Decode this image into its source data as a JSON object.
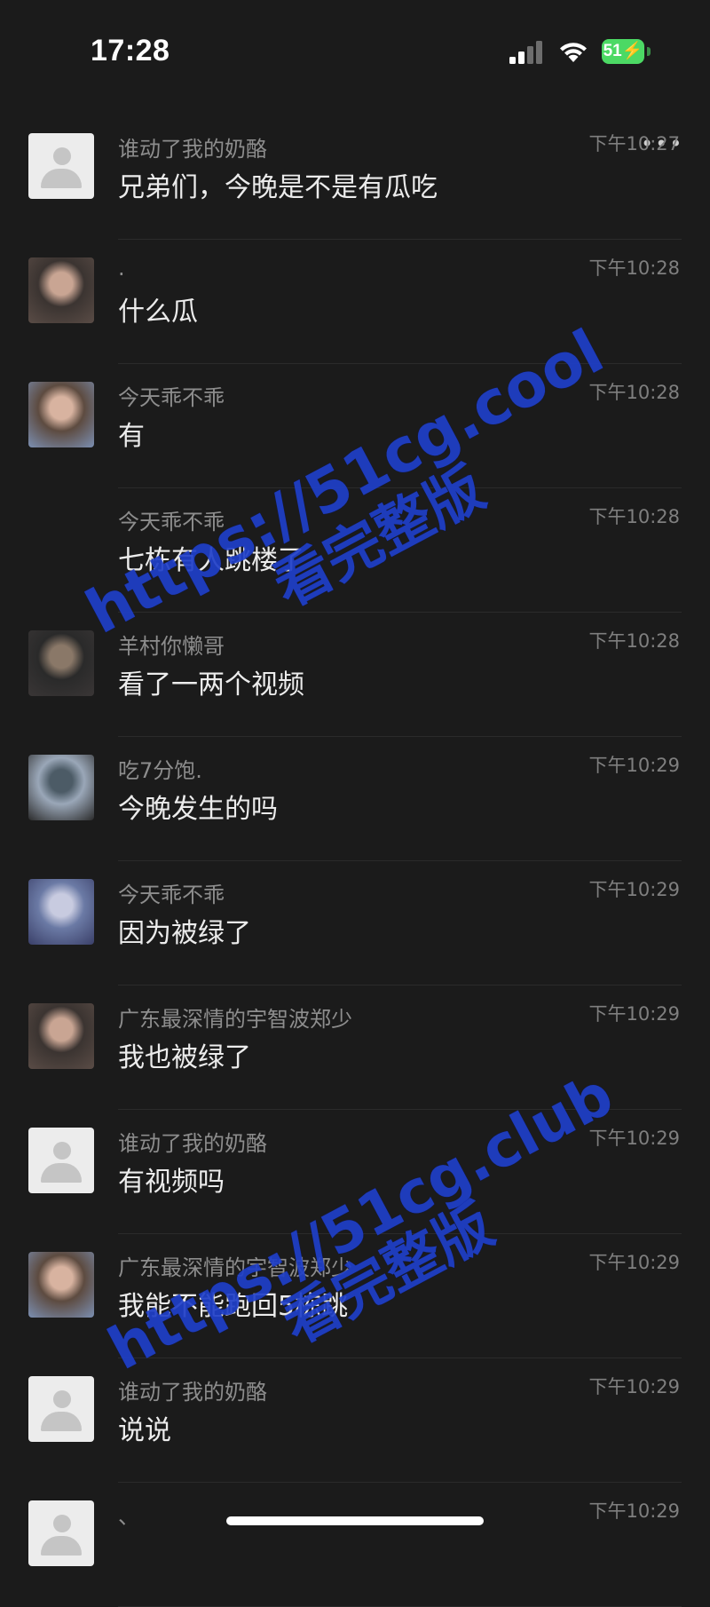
{
  "status_bar": {
    "time": "17:28",
    "battery": "51"
  },
  "header_icons": {
    "back": "chevron-left-icon",
    "more": "more-dots-icon"
  },
  "messages": [
    {
      "sender": "谁动了我的奶酪",
      "time": "下午10:27",
      "text": "兄弟们，今晚是不是有瓜吃",
      "avatar": "default"
    },
    {
      "sender": ".",
      "time": "下午10:28",
      "text": "什么瓜",
      "avatar": "photo"
    },
    {
      "sender": "今天乖不乖",
      "time": "下午10:28",
      "text": "有",
      "avatar": "photo"
    },
    {
      "sender": "今天乖不乖",
      "time": "下午10:28",
      "text": "七栋有人跳楼了",
      "avatar": "none"
    },
    {
      "sender": "羊村你懒哥",
      "time": "下午10:28",
      "text": "看了一两个视频",
      "avatar": "photo"
    },
    {
      "sender": "吃7分饱.",
      "time": "下午10:29",
      "text": "今晚发生的吗",
      "avatar": "photo"
    },
    {
      "sender": "今天乖不乖",
      "time": "下午10:29",
      "text": "因为被绿了",
      "avatar": "photo"
    },
    {
      "sender": "广东最深情的宇智波郑少",
      "time": "下午10:29",
      "text": "我也被绿了",
      "avatar": "photo"
    },
    {
      "sender": "谁动了我的奶酪",
      "time": "下午10:29",
      "text": "有视频吗",
      "avatar": "default"
    },
    {
      "sender": "广东最深情的宇智波郑少",
      "time": "下午10:29",
      "text": "我能不能跑回5栋跳",
      "avatar": "photo"
    },
    {
      "sender": "谁动了我的奶酪",
      "time": "下午10:29",
      "text": "说说",
      "avatar": "default"
    },
    {
      "sender": "、",
      "time": "下午10:29",
      "text": "",
      "avatar": "default"
    }
  ],
  "watermarks": [
    {
      "url": "https://51cg.cool",
      "label": "看完整版"
    },
    {
      "url": "https://51cg.club",
      "label": "看完整版"
    }
  ],
  "colors": {
    "background": "#1b1b1b",
    "watermark": "#1f3fc9",
    "battery": "#4cd964"
  }
}
